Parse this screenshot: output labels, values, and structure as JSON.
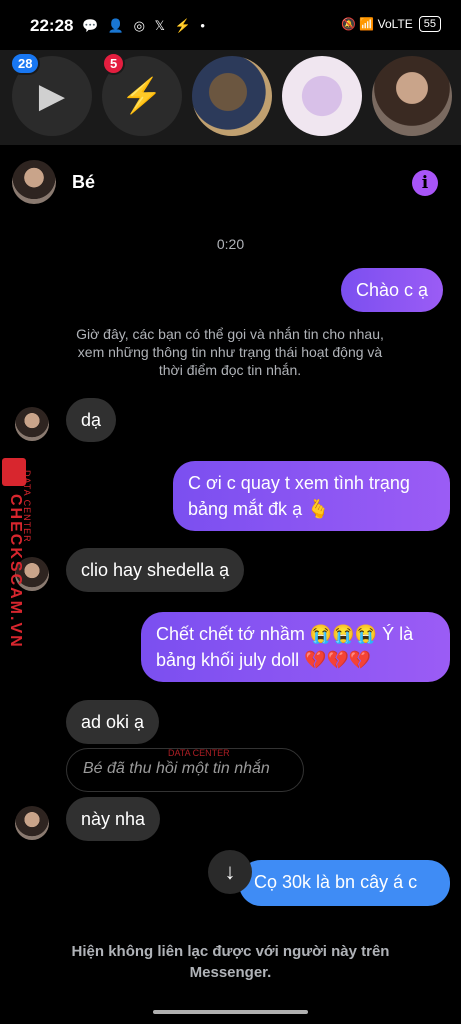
{
  "status_bar": {
    "time": "22:28",
    "battery": "55",
    "left_icons": "💬 👤 ◎ 𝕏 ⚡ •",
    "right_icons": "🔕 📶 VoLTE"
  },
  "heads": [
    {
      "badge": "28",
      "icon": "play-icon"
    },
    {
      "badge": "5",
      "icon": "messenger-icon"
    },
    {
      "icon": "avatar"
    },
    {
      "icon": "avatar"
    },
    {
      "icon": "avatar"
    }
  ],
  "chat": {
    "name": "Bé",
    "timestamp": "0:20",
    "notice": "Giờ đây, các bạn có thể gọi và nhắn tin cho nhau, xem những thông tin như trạng thái hoạt động và thời điểm đọc tin nhắn.",
    "messages": {
      "m1": "Chào c ạ",
      "m2": "dạ",
      "m3": "C ơi c quay t xem tình trạng bảng mắt đk ạ 🫰",
      "m4": "clio hay shedella ạ",
      "m5": "Chết chết tớ nhầm 😭😭😭 Ý là bảng khối july doll 💔💔💔",
      "m6": "ad oki ạ",
      "m7": "Bé đã thu hồi một tin nhắn",
      "m8": "này nha",
      "m9": "Cọ 30k là bn cây á c"
    },
    "footer": "Hiện không liên lạc được với người này trên Messenger."
  },
  "watermark": {
    "brand": "CHECKSCAM.VN",
    "sub": "DATA CENTER"
  }
}
